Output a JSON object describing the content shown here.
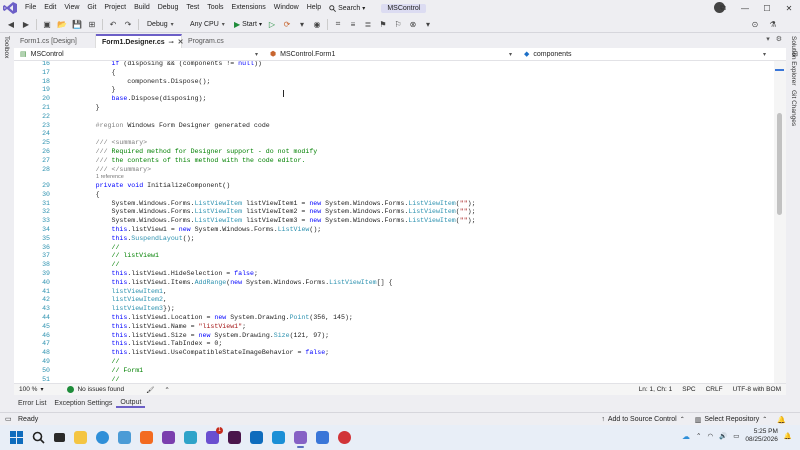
{
  "menubar": {
    "items": [
      "File",
      "Edit",
      "View",
      "Git",
      "Project",
      "Build",
      "Debug",
      "Test",
      "Tools",
      "Extensions",
      "Window",
      "Help"
    ],
    "search_label": "Search",
    "solution_name": "MSControl"
  },
  "toolbar": {
    "config": "Debug",
    "platform": "Any CPU",
    "start_label": "Start"
  },
  "side_panels": {
    "left": "Toolbox",
    "right_top": "Solution Explorer",
    "right_bottom": "Git Changes"
  },
  "tabs": [
    {
      "label": "Form1.cs [Design]",
      "active": false
    },
    {
      "label": "Form1.Designer.cs",
      "active": true
    },
    {
      "label": "Program.cs",
      "active": false
    }
  ],
  "navbar": {
    "project": "MSControl",
    "class": "MSControl.Form1",
    "member": "components"
  },
  "code": {
    "codelens": "1 reference",
    "lines": [
      {
        "n": "16",
        "html": "            <span class='kw'>if</span> (disposing &amp;&amp; (components != <span class='kw'>null</span>))"
      },
      {
        "n": "17",
        "html": "            {"
      },
      {
        "n": "18",
        "html": "                components.Dispose();"
      },
      {
        "n": "19",
        "html": "            }"
      },
      {
        "n": "20",
        "html": "            <span class='kw'>base</span>.Dispose(disposing);"
      },
      {
        "n": "21",
        "html": "        }"
      },
      {
        "n": "22",
        "html": ""
      },
      {
        "n": "23",
        "html": "        <span class='rg'>#region</span> Windows Form Designer generated code"
      },
      {
        "n": "24",
        "html": ""
      },
      {
        "n": "25",
        "html": "        <span class='cmg'>///</span> <span class='cmg'>&lt;summary&gt;</span>"
      },
      {
        "n": "26",
        "html": "        <span class='cmg'>///</span><span class='cm'> Required method for Designer support - do not modify</span>"
      },
      {
        "n": "27",
        "html": "        <span class='cmg'>///</span><span class='cm'> the contents of this method with the code editor.</span>"
      },
      {
        "n": "28",
        "html": "        <span class='cmg'>///</span> <span class='cmg'>&lt;/summary&gt;</span>"
      },
      {
        "n": "29",
        "html": "        <span class='kw'>private</span> <span class='kw'>void</span> InitializeComponent()"
      },
      {
        "n": "30",
        "html": "        {"
      },
      {
        "n": "31",
        "html": "            System.Windows.Forms.<span class='ty'>ListViewItem</span> listViewItem1 = <span class='kw'>new</span> System.Windows.Forms.<span class='ty'>ListViewItem</span>(<span class='str'>\"\"</span>);"
      },
      {
        "n": "32",
        "html": "            System.Windows.Forms.<span class='ty'>ListViewItem</span> listViewItem2 = <span class='kw'>new</span> System.Windows.Forms.<span class='ty'>ListViewItem</span>(<span class='str'>\"\"</span>);"
      },
      {
        "n": "33",
        "html": "            System.Windows.Forms.<span class='ty'>ListViewItem</span> listViewItem3 = <span class='kw'>new</span> System.Windows.Forms.<span class='ty'>ListViewItem</span>(<span class='str'>\"\"</span>);"
      },
      {
        "n": "34",
        "html": "            <span class='kw'>this</span>.listView1 = <span class='kw'>new</span> System.Windows.Forms.<span class='ty'>ListView</span>();"
      },
      {
        "n": "35",
        "html": "            <span class='kw'>this</span>.<span class='ty'>SuspendLayout</span>();"
      },
      {
        "n": "36",
        "html": "            <span class='cm'>//</span>"
      },
      {
        "n": "37",
        "html": "            <span class='cm'>// listView1</span>"
      },
      {
        "n": "38",
        "html": "            <span class='cm'>//</span>"
      },
      {
        "n": "39",
        "html": "            <span class='kw'>this</span>.listView1.HideSelection = <span class='kw'>false</span>;"
      },
      {
        "n": "40",
        "html": "            <span class='kw'>this</span>.listView1.Items.<span class='ty'>AddRange</span>(<span class='kw'>new</span> System.Windows.Forms.<span class='ty'>ListViewItem</span>[] {"
      },
      {
        "n": "41",
        "html": "            <span class='ty'>listViewItem1</span>,"
      },
      {
        "n": "42",
        "html": "            <span class='ty'>listViewItem2</span>,"
      },
      {
        "n": "43",
        "html": "            <span class='ty'>listViewItem3</span>});"
      },
      {
        "n": "44",
        "html": "            <span class='kw'>this</span>.listView1.Location = <span class='kw'>new</span> System.Drawing.<span class='ty'>Point</span>(356, 145);"
      },
      {
        "n": "45",
        "html": "            <span class='kw'>this</span>.listView1.Name = <span class='str'>\"listView1\"</span>;"
      },
      {
        "n": "46",
        "html": "            <span class='kw'>this</span>.listView1.Size = <span class='kw'>new</span> System.Drawing.<span class='ty'>Size</span>(121, 97);"
      },
      {
        "n": "47",
        "html": "            <span class='kw'>this</span>.listView1.TabIndex = 0;"
      },
      {
        "n": "48",
        "html": "            <span class='kw'>this</span>.listView1.UseCompatibleStateImageBehavior = <span class='kw'>false</span>;"
      },
      {
        "n": "49",
        "html": "            <span class='cm'>//</span>"
      },
      {
        "n": "50",
        "html": "            <span class='cm'>// Form1</span>"
      },
      {
        "n": "51",
        "html": "            <span class='cm'>//</span>"
      }
    ]
  },
  "editor_status": {
    "zoom": "100 %",
    "issues": "No issues found",
    "position": "Ln: 1, Ch: 1",
    "whitespace": "SPC",
    "line_ending": "CRLF",
    "encoding": "UTF-8 with BOM"
  },
  "panel_tabs": [
    "Error List",
    "Exception Settings",
    "Output"
  ],
  "statusbar": {
    "ready": "Ready",
    "source_control": "Add to Source Control",
    "repository": "Select Repository"
  },
  "taskbar": {
    "time": "5:25 PM",
    "date": "08/25/2026",
    "badge_count": "1"
  },
  "colors": {
    "accent": "#6c5fc7",
    "keyword": "#0000ff",
    "type": "#2b91af",
    "string": "#a31515",
    "comment": "#008000"
  }
}
